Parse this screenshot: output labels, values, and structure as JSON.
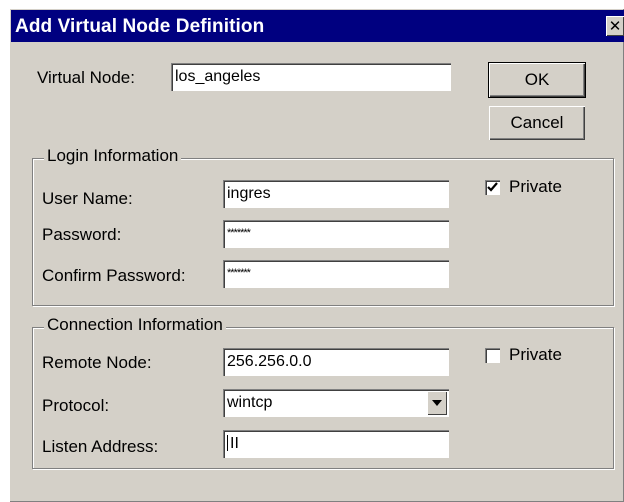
{
  "window": {
    "title": "Add Virtual Node Definition",
    "close_glyph": "✕"
  },
  "buttons": {
    "ok": "OK",
    "cancel": "Cancel"
  },
  "virtual_node": {
    "label": "Virtual Node:",
    "value": "los_angeles"
  },
  "login": {
    "legend": "Login Information",
    "user_name_label": "User Name:",
    "user_name_value": "ingres",
    "password_label": "Password:",
    "password_value": "*******",
    "confirm_label": "Confirm Password:",
    "confirm_value": "*******",
    "private_label": "Private",
    "private_checked": true
  },
  "connection": {
    "legend": "Connection Information",
    "remote_node_label": "Remote Node:",
    "remote_node_value": "256.256.0.0",
    "protocol_label": "Protocol:",
    "protocol_value": "wintcp",
    "listen_label": "Listen Address:",
    "listen_value": "II",
    "private_label": "Private",
    "private_checked": false
  },
  "icons": {
    "close": "close-icon",
    "check": "checkmark-icon",
    "dropdown": "dropdown-arrow-icon"
  },
  "colors": {
    "titlebar": "#000080",
    "face": "#d4d0c8"
  }
}
